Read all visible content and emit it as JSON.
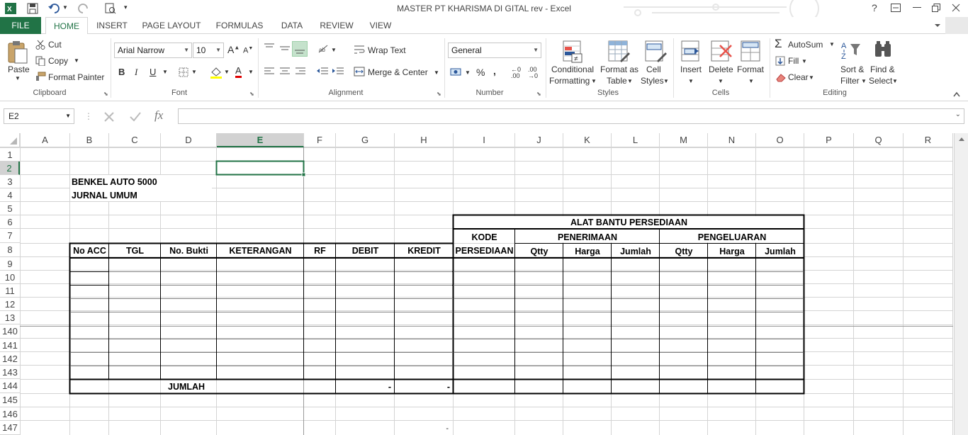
{
  "window": {
    "title": "MASTER PT KHARISMA DI GITAL rev - Excel",
    "help": "?"
  },
  "tabs": {
    "file": "FILE",
    "home": "HOME",
    "insert": "INSERT",
    "page_layout": "PAGE LAYOUT",
    "formulas": "FORMULAS",
    "data": "DATA",
    "review": "REVIEW",
    "view": "VIEW"
  },
  "ribbon": {
    "clipboard": {
      "paste": "Paste",
      "cut": "Cut",
      "copy": "Copy",
      "format_painter": "Format Painter",
      "label": "Clipboard"
    },
    "font": {
      "name": "Arial Narrow",
      "size": "10",
      "bold": "B",
      "italic": "I",
      "underline": "U",
      "font_color": "A",
      "label": "Font"
    },
    "alignment": {
      "wrap_text": "Wrap Text",
      "merge_center": "Merge & Center",
      "label": "Alignment"
    },
    "number": {
      "format": "General",
      "percent": "%",
      "comma": ",",
      "label": "Number"
    },
    "styles": {
      "conditional": "Conditional",
      "conditional2": "Formatting",
      "format_as": "Format as",
      "format_as2": "Table",
      "cell": "Cell",
      "cell2": "Styles",
      "label": "Styles"
    },
    "cells": {
      "insert": "Insert",
      "delete": "Delete",
      "format": "Format",
      "label": "Cells"
    },
    "editing": {
      "autosum": "AutoSum",
      "fill": "Fill",
      "clear": "Clear",
      "sort": "Sort &",
      "sort2": "Filter",
      "find": "Find &",
      "find2": "Select",
      "label": "Editing"
    }
  },
  "formula_bar": {
    "name_box": "E2",
    "fx": "fx",
    "value": ""
  },
  "columns": [
    "A",
    "B",
    "C",
    "D",
    "E",
    "F",
    "G",
    "H",
    "I",
    "J",
    "K",
    "L",
    "M",
    "N",
    "O",
    "P",
    "Q",
    "R"
  ],
  "rows": [
    "1",
    "2",
    "3",
    "4",
    "5",
    "6",
    "7",
    "8",
    "9",
    "10",
    "11",
    "12",
    "13",
    "140",
    "141",
    "142",
    "143",
    "144",
    "145",
    "146",
    "147"
  ],
  "sheet": {
    "company": "BENKEL AUTO 5000",
    "journal": "JURNAL UMUM",
    "headers": {
      "no_acc": "No ACC",
      "tgl": "TGL",
      "no_bukti": "No. Bukti",
      "keterangan": "KETERANGAN",
      "rf": "RF",
      "debit": "DEBIT",
      "kredit": "KREDIT"
    },
    "aux": {
      "title": "ALAT BANTU PERSEDIAAN",
      "kode": "KODE",
      "persediaan": "PERSEDIAAN",
      "penerimaan": "PENERIMAAN",
      "pengeluaran": "PENGELUARAN",
      "qtty": "Qtty",
      "harga": "Harga",
      "jumlah": "Jumlah"
    },
    "total_label": "JUMLAH",
    "total_debit": "-",
    "total_kredit": "-",
    "row147_dash": "-"
  },
  "colors": {
    "accent": "#217346",
    "grid": "#d4d4d4",
    "selected_header": "#d2d2d2"
  }
}
